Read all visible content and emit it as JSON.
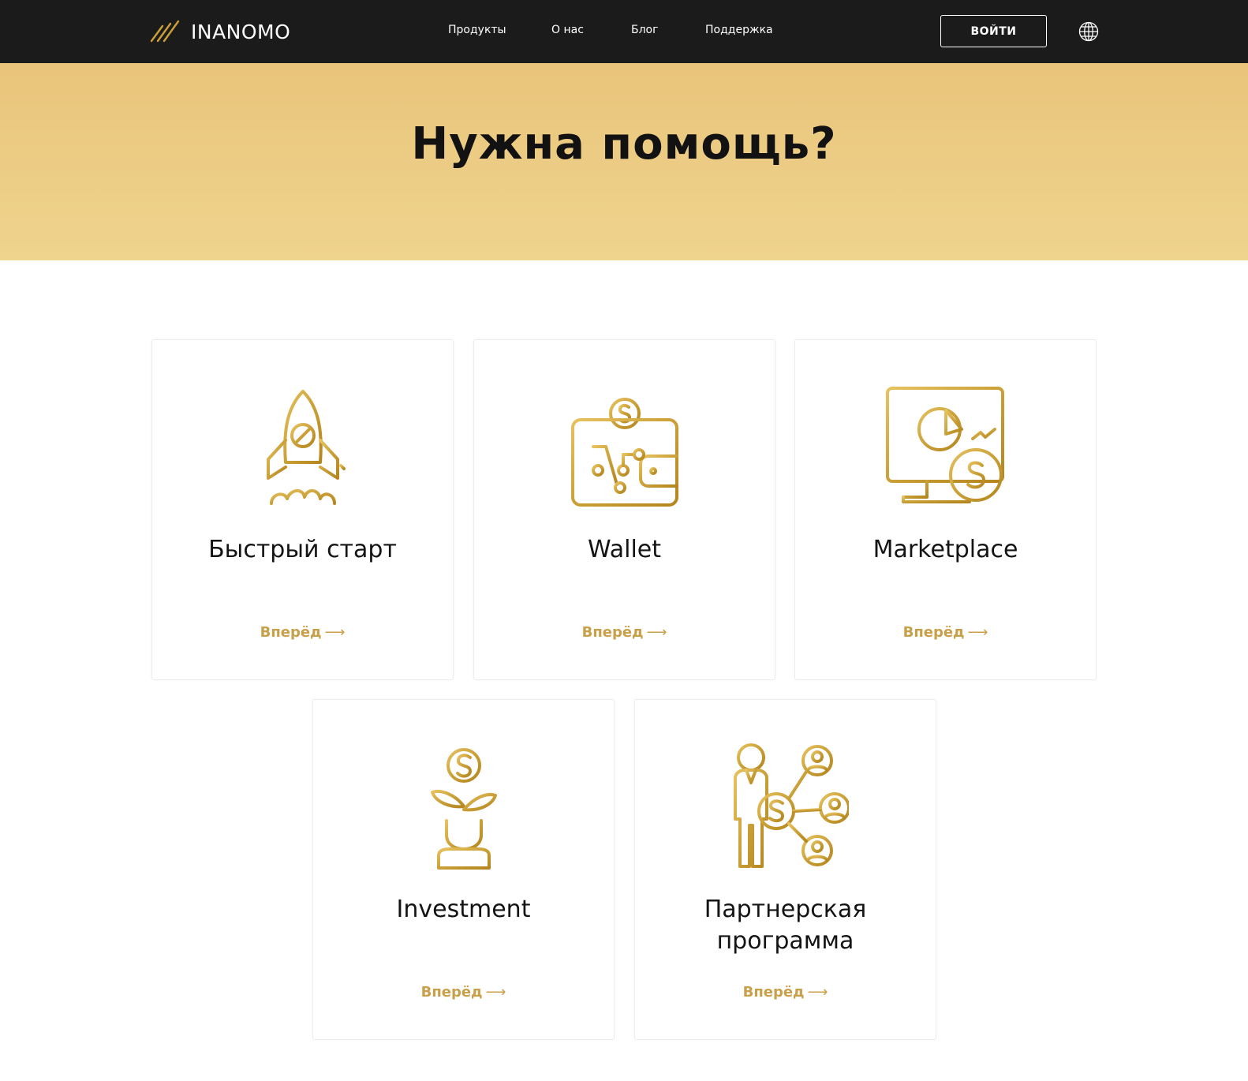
{
  "header": {
    "brand": "INANOMO",
    "nav": [
      {
        "label": "Продукты"
      },
      {
        "label": "О нас"
      },
      {
        "label": "Блог"
      },
      {
        "label": "Поддержка"
      }
    ],
    "login_label": "ВОЙТИ",
    "language_icon": "globe-icon"
  },
  "hero": {
    "title": "Нужна помощь?"
  },
  "cards": [
    {
      "title": "Быстрый старт",
      "link": "Вперёд",
      "icon": "rocket-icon"
    },
    {
      "title": "Wallet",
      "link": "Вперёд",
      "icon": "wallet-icon"
    },
    {
      "title": "Marketplace",
      "link": "Вперёд",
      "icon": "monitor-chart-icon"
    },
    {
      "title": "Investment",
      "link": "Вперёд",
      "icon": "money-plant-icon"
    },
    {
      "title": "Партнерская программа",
      "link": "Вперёд",
      "icon": "partner-network-icon"
    }
  ],
  "colors": {
    "header_bg": "#1b1b1b",
    "hero_gradient_top": "#e9c47a",
    "hero_gradient_bottom": "#efd48e",
    "accent_gold": "#c9a04a"
  }
}
